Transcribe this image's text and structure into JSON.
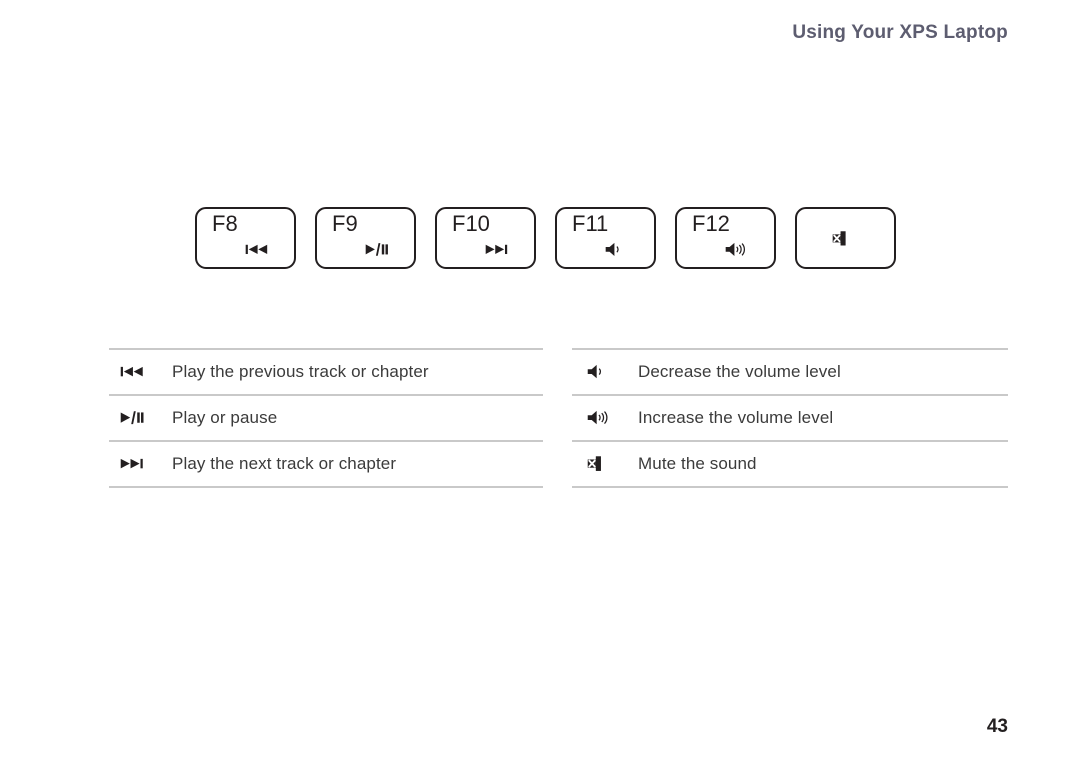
{
  "header": {
    "title": "Using Your XPS Laptop",
    "color": "#5d5d70"
  },
  "keys": [
    {
      "label": "F8",
      "icon": "previous-track-icon",
      "icon_centered": false
    },
    {
      "label": "F9",
      "icon": "play-pause-icon",
      "icon_centered": false
    },
    {
      "label": "F10",
      "icon": "next-track-icon",
      "icon_centered": false
    },
    {
      "label": "F11",
      "icon": "volume-down-icon",
      "icon_centered": false
    },
    {
      "label": "F12",
      "icon": "volume-up-icon",
      "icon_centered": false
    },
    {
      "label": "",
      "icon": "mute-icon",
      "icon_centered": true
    }
  ],
  "tables": {
    "left": {
      "rows": [
        {
          "icon": "previous-track-icon",
          "description": "Play the previous track or chapter"
        },
        {
          "icon": "play-pause-icon",
          "description": "Play or pause"
        },
        {
          "icon": "next-track-icon",
          "description": "Play the next track or chapter"
        }
      ]
    },
    "right": {
      "rows": [
        {
          "icon": "volume-down-icon",
          "description": "Decrease the volume level"
        },
        {
          "icon": "volume-up-icon",
          "description": "Increase the volume level"
        },
        {
          "icon": "mute-icon",
          "description": "Mute the sound"
        }
      ]
    }
  },
  "footer": {
    "page_number": "43"
  },
  "colors": {
    "ink": "#231f20",
    "body_text": "#3b3b3b",
    "rule": "#c9c9c9",
    "header": "#5d5d70"
  }
}
